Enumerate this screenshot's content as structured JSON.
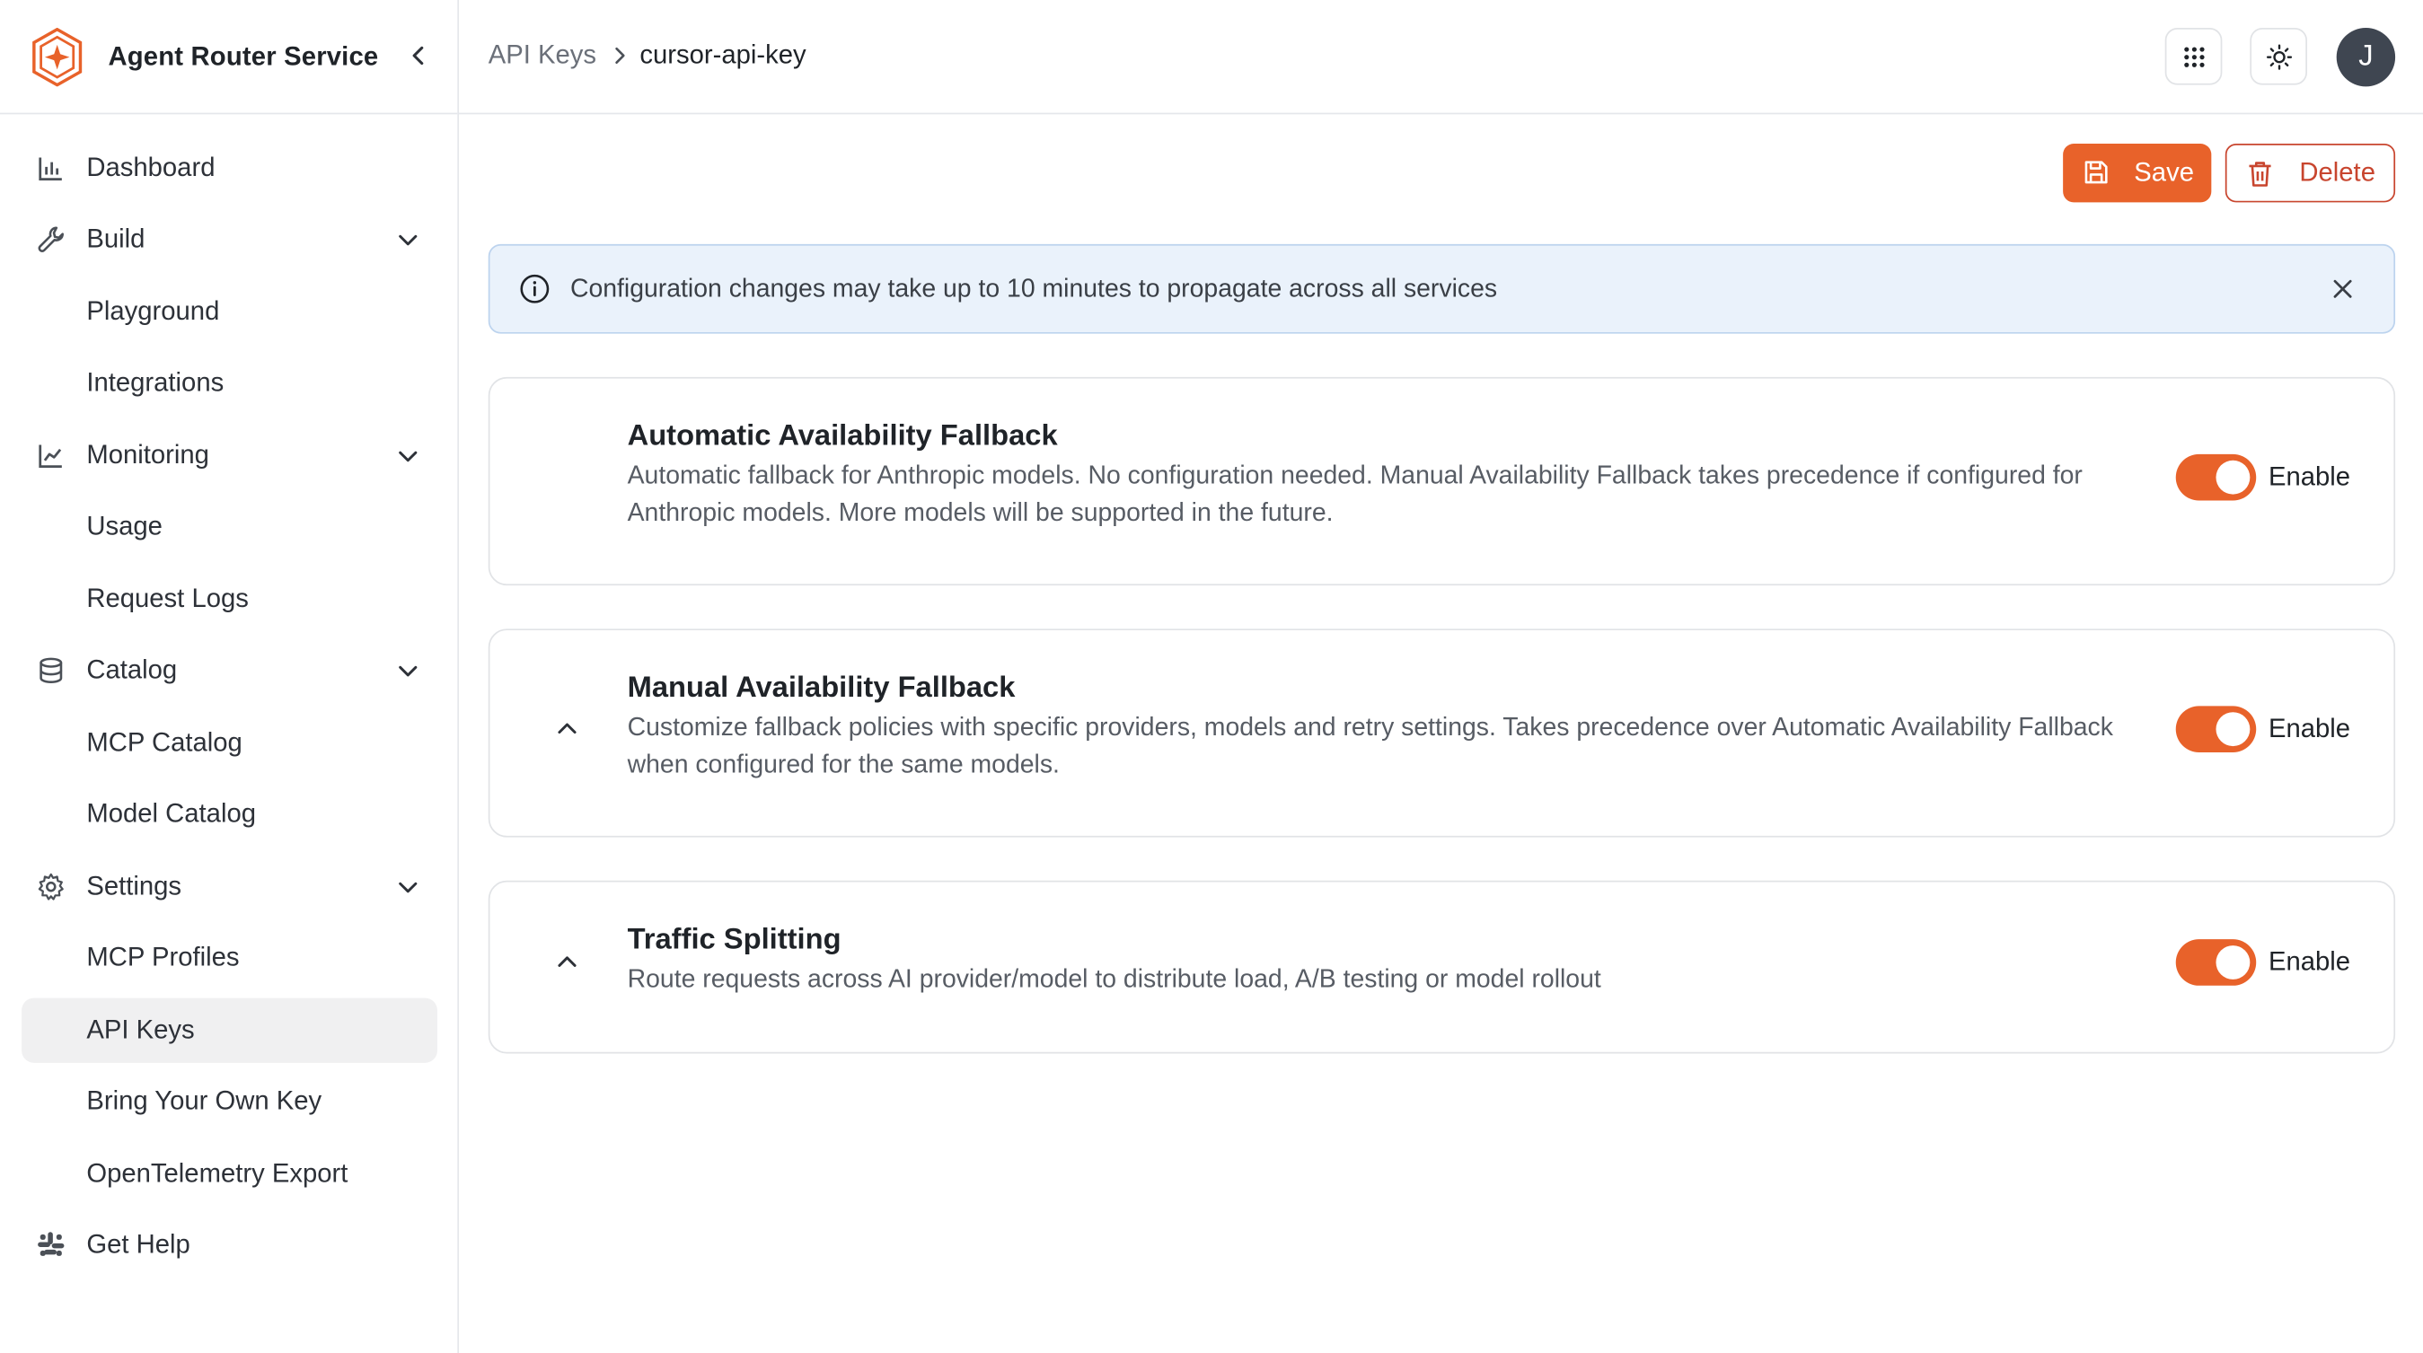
{
  "app": {
    "title": "Agent Router Service",
    "accent_color": "#e8622a"
  },
  "sidebar": {
    "items": [
      {
        "label": "Dashboard",
        "icon": "bar-chart-icon"
      },
      {
        "label": "Build",
        "icon": "wrench-icon",
        "expandable": true
      },
      {
        "label": "Playground",
        "sub": true
      },
      {
        "label": "Integrations",
        "sub": true
      },
      {
        "label": "Monitoring",
        "icon": "line-chart-icon",
        "expandable": true
      },
      {
        "label": "Usage",
        "sub": true
      },
      {
        "label": "Request Logs",
        "sub": true
      },
      {
        "label": "Catalog",
        "icon": "database-icon",
        "expandable": true
      },
      {
        "label": "MCP Catalog",
        "sub": true
      },
      {
        "label": "Model Catalog",
        "sub": true
      },
      {
        "label": "Settings",
        "icon": "gear-icon",
        "expandable": true
      },
      {
        "label": "MCP Profiles",
        "sub": true
      },
      {
        "label": "API Keys",
        "sub": true,
        "active": true
      },
      {
        "label": "Bring Your Own Key",
        "sub": true
      },
      {
        "label": "OpenTelemetry Export",
        "sub": true
      },
      {
        "label": "Get Help",
        "icon": "slack-icon"
      }
    ]
  },
  "header": {
    "breadcrumb": [
      "API Keys",
      "cursor-api-key"
    ],
    "avatar_initial": "J"
  },
  "toolbar": {
    "save_label": "Save",
    "delete_label": "Delete"
  },
  "alert": {
    "text": "Configuration changes may take up to 10 minutes to propagate across all services"
  },
  "cards": [
    {
      "title": "Automatic Availability Fallback",
      "description": "Automatic fallback for Anthropic models. No configuration needed. Manual Availability Fallback takes precedence if configured for Anthropic models. More models will be supported in the future.",
      "toggle_label": "Enable",
      "enabled": true
    },
    {
      "title": "Manual Availability Fallback",
      "description": "Customize fallback policies with specific providers, models and retry settings. Takes precedence over Automatic Availability Fallback when configured for the same models.",
      "toggle_label": "Enable",
      "enabled": true
    },
    {
      "title": "Traffic Splitting",
      "description": "Route requests across AI provider/model to distribute load, A/B testing or model rollout",
      "toggle_label": "Enable",
      "enabled": true
    }
  ]
}
